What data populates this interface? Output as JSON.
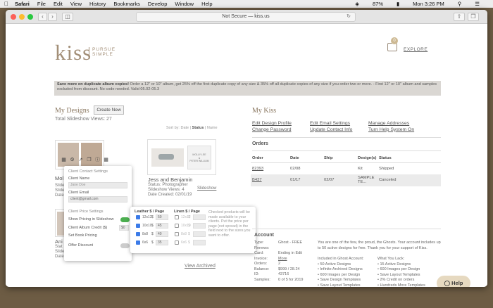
{
  "menubar": {
    "app": "Safari",
    "items": [
      "File",
      "Edit",
      "View",
      "History",
      "Bookmarks",
      "Develop",
      "Window",
      "Help"
    ],
    "battery": "87%",
    "clock": "Mon 3:26 PM"
  },
  "browser": {
    "url_text": "Not Secure — kiss.us"
  },
  "header": {
    "logo_main": "kiss",
    "logo_sub_1": "PURSUE",
    "logo_sub_2": "SIMPLE",
    "cart_count": "0",
    "explore": "EXPLORE"
  },
  "promo": {
    "bold": "Save more on duplicate album copies!",
    "text": " Order a 12\" or 10\" album, get 25% off the first duplicate copy of any size & 35% off all duplicate copies of any size if you order two or more. - First 12\" or 10\" album and samples excluded from discount. No code needed. Valid 05.02-05.3"
  },
  "designs": {
    "title": "My Designs",
    "create_button": "Create New",
    "slideshow_views": "Total Slideshow Views: 27",
    "sort_by_label": "Sort by: Date |",
    "sort_active": "Status",
    "sort_name": "| Name",
    "card1": {
      "name": "Mol",
      "line1": "Slide",
      "line2": "Slide",
      "line3": "Date"
    },
    "card2": {
      "name": "Jess and Benjamin",
      "status": "Status: Photographer",
      "views": "Slideshow Views: 4",
      "created": "Date Created: 02/01/19",
      "link": "Slideshow",
      "book_title_1": "MOLLY LEE",
      "book_title_2": "&",
      "book_title_3": "PETER WILLIUM"
    },
    "card3": {
      "name": "Ani",
      "line1": "Stat",
      "line2": "SlideShow Views: 3",
      "line3": "Date Created: 02/27/19",
      "link": "andelson"
    },
    "view_archived": "View Archived"
  },
  "client_panel": {
    "contact_title": "Client Contact Settings",
    "name_label": "Client Name",
    "name_placeholder": "Jane Doe",
    "email_label": "Client Email",
    "email_value": "client@gmail.com",
    "price_title": "Client Price Settings",
    "show_pricing": "Show Pricing in Slideshow",
    "album_credit": "Client Album Credit ($)",
    "album_credit_value": "$0",
    "book_pricing": "Set Book Pricing",
    "offer_discount": "Offer Discount"
  },
  "price_panel": {
    "leather_title": "Leather $ / Page",
    "linen_title": "Linen $ / Page",
    "rows": [
      {
        "size": "12x12",
        "cur": "$",
        "price": "50",
        "linen_size": "12x12",
        "linen_cur": "$"
      },
      {
        "size": "10x10",
        "cur": "$",
        "price": "45",
        "linen_size": "10x10",
        "linen_cur": "$"
      },
      {
        "size": "8x8",
        "cur": "$",
        "price": "40",
        "linen_size": "8x8",
        "linen_cur": "$"
      },
      {
        "size": "6x6",
        "cur": "$",
        "price": "35",
        "linen_size": "6x6",
        "linen_cur": "$"
      }
    ],
    "note": "Checked products will be made available to your clients. Put the price per page (not spread) in the field next to the sizes you want to offer."
  },
  "kiss": {
    "title": "My Kiss",
    "links_col1": [
      "Edit Design Profile",
      "Change Password"
    ],
    "links_col2": [
      "Edit Email Settings",
      "Update Contact Info"
    ],
    "links_col3": [
      "Manage Addresses",
      "Turn Help System On"
    ],
    "orders_title": "Orders",
    "order_headers": [
      "Order",
      "Date",
      "Ship",
      "Design(s)",
      "Status"
    ],
    "orders": [
      {
        "order": "82393",
        "date": "02/08",
        "ship": "",
        "design": "Kit",
        "status": "Shipped"
      },
      {
        "order": "B437",
        "date": "01/17",
        "ship": "02/07",
        "design": "SAMPLE TE...",
        "status": "Canceled"
      }
    ]
  },
  "account": {
    "title": "Account",
    "labels": [
      "Type:",
      "Renews:",
      "Card:",
      "Invoice:",
      "Orders:",
      "Balance:",
      "ID:",
      "Samples:"
    ],
    "values": [
      "Ghost - FREE",
      "",
      "Ending in Edit",
      "More",
      "2",
      "$999 / 28.24",
      "43716",
      "0 of 5 for 2019"
    ],
    "desc": "You are one of the few, the proud, the Ghosts. Your account includes up to 50 active designs for free. Thank you for your support of Kiss.",
    "included_title": "Included in Ghost Account:",
    "included": [
      "50 Active Designs",
      "Infinite Archived Designs",
      "600 Images per Design",
      "Save Design Templates",
      "Save Layout Templates",
      "Discount Up"
    ],
    "lack_title": "What You Lack:",
    "lack": [
      "15 Active Designs",
      "600 Images per Design",
      "Save Layout Templates",
      "2% Credit on orders",
      "Hundreds More Templates"
    ]
  },
  "help_button": "Help",
  "colors": {
    "brand": "#a38f78",
    "toggle_on": "#4caf50",
    "checkbox": "#3b7be8"
  }
}
